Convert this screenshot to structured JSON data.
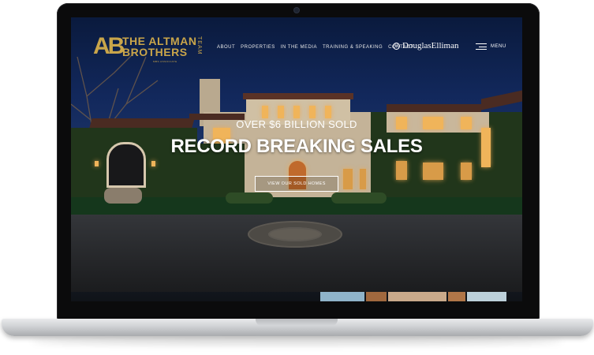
{
  "site": {
    "logo": {
      "monogram": "AB",
      "line1": "THE ALTMAN",
      "line2": "BROTHERS",
      "team": "TEAM",
      "subtitle": "MBS ASSOCIATE"
    },
    "nav": [
      "ABOUT",
      "PROPERTIES",
      "IN THE MEDIA",
      "TRAINING & SPEAKING",
      "CONTACT"
    ],
    "brand": {
      "mark": "D",
      "name": "DouglasElliman"
    },
    "menu_label": "MENU"
  },
  "hero": {
    "kicker": "OVER $6 BILLION SOLD",
    "title": "RECORD BREAKING SALES",
    "button": "VIEW OUR SOLD HOMES"
  },
  "colors": {
    "gold": "#c9a54a",
    "sky": "#12285c",
    "window_glow": "#f0b45a"
  },
  "icons": {
    "menu": "hamburger-icon",
    "brand": "douglas-elliman-logo-icon"
  }
}
